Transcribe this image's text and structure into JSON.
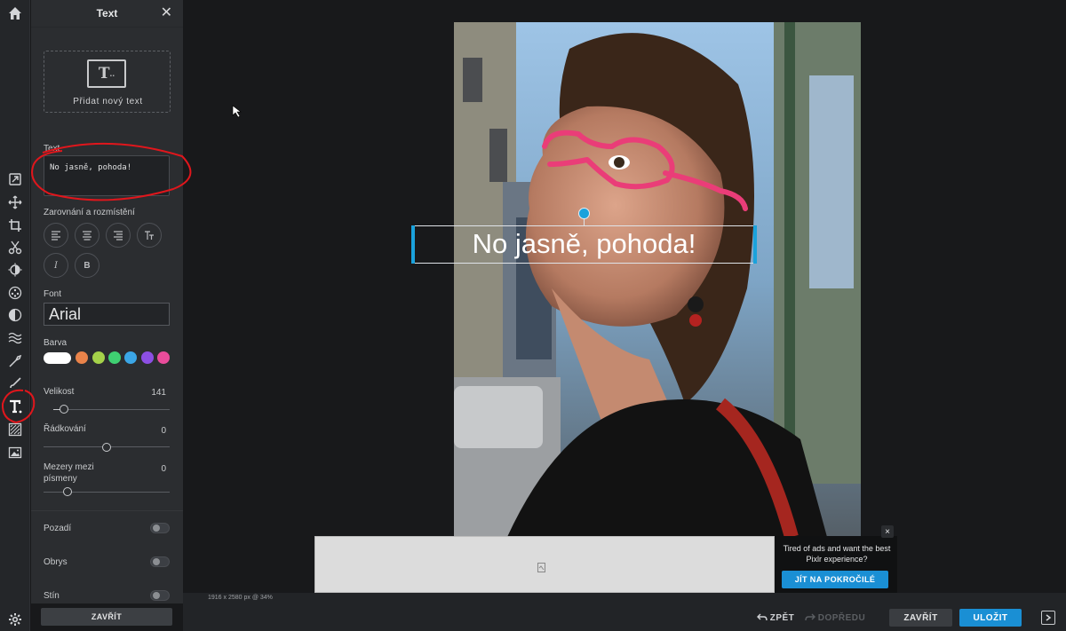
{
  "panel": {
    "title": "Text",
    "add_text_label": "Přidat nový text",
    "text_section_label": "Text",
    "text_value": "No jasně, pohoda!",
    "align_section_label": "Zarovnání a rozmístění",
    "font_label": "Font",
    "font_value": "Arial",
    "color_label": "Barva",
    "swatches": [
      "#ffffff",
      "#e9834a",
      "#a5d24a",
      "#3fd072",
      "#3ba6e6",
      "#8c4fe3",
      "#e94c9b"
    ],
    "size_label": "Velikost",
    "size_value": "141",
    "line_spacing_label": "Řádkování",
    "line_spacing_value": "0",
    "letter_spacing_label_1": "Mezery mezi",
    "letter_spacing_label_2": "písmeny",
    "letter_spacing_value": "0",
    "background_label": "Pozadí",
    "outline_label": "Obrys",
    "shadow_label": "Stín",
    "close_label": "ZAVŘÍT"
  },
  "canvas": {
    "overlay_text": "No jasně, pohoda!",
    "dimensions": "1916 x 2580 px @ 34%"
  },
  "ad": {
    "message": "Tired of ads and want the best Pixlr experience?",
    "cta": "JÍT NA POKROČILÉ",
    "close": "×"
  },
  "bottom": {
    "undo": "ZPĚT",
    "redo": "DOPŘEDU",
    "close": "ZAVŘÍT",
    "save": "ULOŽIT"
  },
  "colors": {
    "accent": "#1a8fd4",
    "annotation": "#e0161c",
    "glasses": "#ea3d78"
  }
}
